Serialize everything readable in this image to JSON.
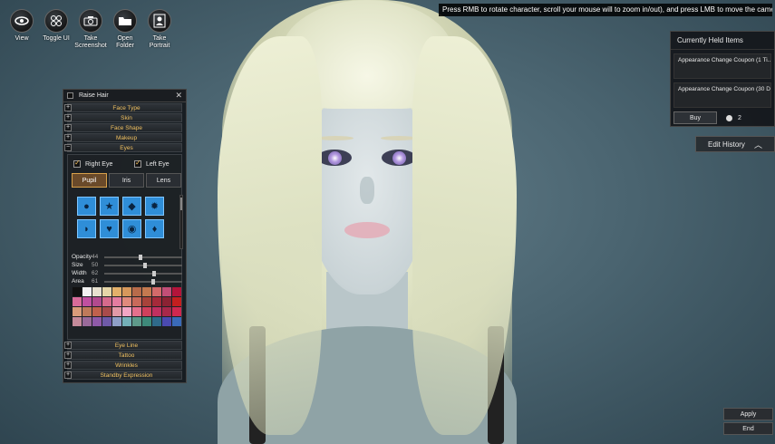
{
  "toolbar": {
    "items": [
      {
        "label": "View",
        "icon": "eye-icon"
      },
      {
        "label": "Toggle UI",
        "icon": "dots-icon"
      },
      {
        "label": "Take Screenshot",
        "icon": "camera-icon"
      },
      {
        "label": "Open Folder",
        "icon": "folder-icon"
      },
      {
        "label": "Take Portrait",
        "icon": "portrait-icon"
      }
    ]
  },
  "hint": "Press RMB to rotate character, scroll your mouse will to zoom in/out), and press LMB to move the camera",
  "panel": {
    "header": "Raise Hair",
    "close": "✕",
    "sections_top": [
      "Face Type",
      "Skin",
      "Face Shape",
      "Makeup",
      "Eyes"
    ],
    "eyes": {
      "right_eye": "Right Eye",
      "left_eye": "Left Eye",
      "tabs": [
        "Pupil",
        "Iris",
        "Lens"
      ],
      "active_tab": "Pupil",
      "shapes": [
        "●",
        "★",
        "◆",
        "✹",
        "◗",
        "♥",
        "◉",
        "♦"
      ],
      "sliders": [
        {
          "label": "Opacity",
          "value": "44",
          "level": 0.44
        },
        {
          "label": "Size",
          "value": "50",
          "level": 0.5
        },
        {
          "label": "Width",
          "value": "62",
          "level": 0.62
        },
        {
          "label": "Area",
          "value": "61",
          "level": 0.61
        }
      ],
      "palette": [
        "#111111",
        "#f2f2f2",
        "#e8e2d0",
        "#e6d6a8",
        "#e3b06a",
        "#d7985b",
        "#b86b4a",
        "#c4794f",
        "#d36a6a",
        "#c24e77",
        "#b4143a",
        "#d86b9a",
        "#c050a0",
        "#b24a8e",
        "#d66a8c",
        "#e47ca0",
        "#e08a7c",
        "#c96a5a",
        "#a8433a",
        "#a52a3a",
        "#8b2233",
        "#c41f1f",
        "#d99c7a",
        "#bf7a5a",
        "#c0614c",
        "#a94b4b",
        "#e39aa7",
        "#f2a6c4",
        "#e6708c",
        "#d1405c",
        "#c03060",
        "#a8284a",
        "#d0284f",
        "#c48a9a",
        "#9a6a9a",
        "#8f5aa8",
        "#6f5aa8",
        "#8fa0c8",
        "#74b0b8",
        "#5e9a8a",
        "#3e8a7a",
        "#2f6a8a",
        "#4a4ab0",
        "#3a6ab8"
      ]
    },
    "sections_bottom": [
      "Eye Line",
      "Tattoo",
      "Wrinkles",
      "Standby Expression"
    ]
  },
  "held_items": {
    "title": "Currently Held Items",
    "coupons": [
      "Appearance Change Coupon (1 Ti...",
      "Appearance Change Coupon (30 D..."
    ],
    "buy": "Buy",
    "pearl_count": "2"
  },
  "edit_history": {
    "label": "Edit History",
    "chevron": "︿"
  },
  "buttons": {
    "apply": "Apply",
    "end": "End"
  },
  "colors": {
    "accent": "#f0c060",
    "swatch_blue": "#2f8ed8",
    "active_tab": "#6a4a2a"
  }
}
